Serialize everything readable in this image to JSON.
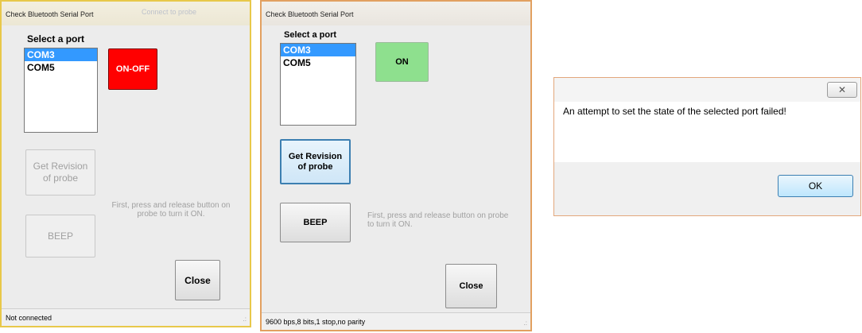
{
  "window1": {
    "title": "Check Bluetooth Serial Port",
    "background_title": "Connect to probe",
    "select_label": "Select a port",
    "ports": [
      "COM3",
      "COM5"
    ],
    "selected_port": "COM3",
    "power_button": "ON-OFF",
    "revision_button": "Get Revision of probe",
    "hint": "First, press and release button on probe to turn it ON.",
    "beep_button": "BEEP",
    "close_button": "Close",
    "status": "Not connected",
    "grip": ".:"
  },
  "window2": {
    "title": "Check Bluetooth Serial Port",
    "select_label": "Select a port",
    "ports": [
      "COM3",
      "COM5"
    ],
    "selected_port": "COM3",
    "power_button": "ON",
    "revision_button": "Get Revision of probe",
    "hint": "First, press and release button on probe to turn it ON.",
    "beep_button": "BEEP",
    "close_button": "Close",
    "status": "9600 bps,8 bits,1 stop,no parity",
    "grip": ".:"
  },
  "dialog": {
    "close_glyph": "✕",
    "message": "An attempt to set the state of the selected port failed!",
    "ok_button": "OK"
  },
  "colors": {
    "selection": "#3399ff",
    "power_off_red": "#ff0000",
    "power_on_green": "#8ee08e",
    "window1_frame": "#e8c84a",
    "window2_frame": "#e2a060"
  }
}
